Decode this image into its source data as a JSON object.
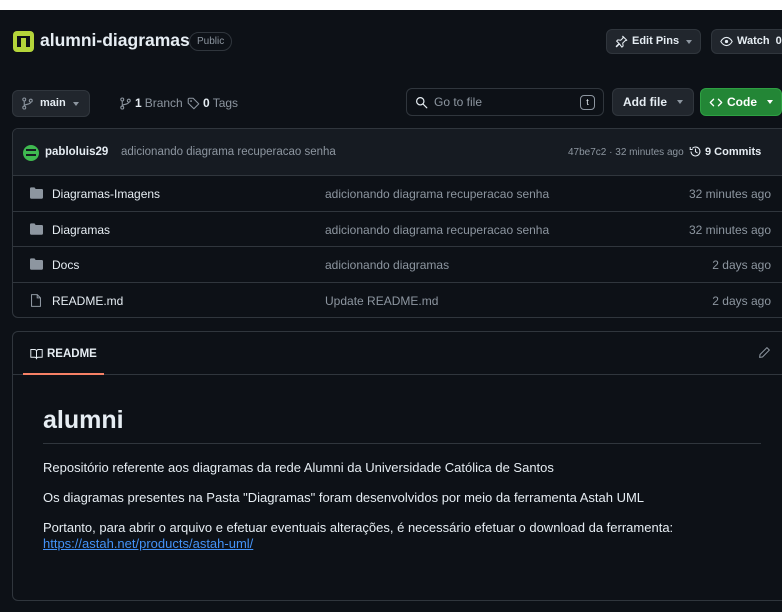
{
  "repo": {
    "name": "alumni-diagramas",
    "visibility": "Public",
    "edit_pins_label": "Edit Pins",
    "watch_label": "Watch",
    "watch_count": "0"
  },
  "toolbar": {
    "branch": "main",
    "branch_count": "1",
    "branch_label": "Branch",
    "tag_count": "0",
    "tag_label": "Tags",
    "goto_placeholder": "Go to file",
    "goto_shortcut": "t",
    "add_file_label": "Add file",
    "code_label": "Code"
  },
  "commit": {
    "author": "pabloluis29",
    "message": "adicionando diagrama recuperacao senha",
    "hash_time": "47be7c2 · 32 minutes ago",
    "commits_label": "9 Commits"
  },
  "files": [
    {
      "name": "Diagramas-Imagens",
      "type": "folder",
      "message": "adicionando diagrama recuperacao senha",
      "age": "32 minutes ago"
    },
    {
      "name": "Diagramas",
      "type": "folder",
      "message": "adicionando diagrama recuperacao senha",
      "age": "32 minutes ago"
    },
    {
      "name": "Docs",
      "type": "folder",
      "message": "adicionando diagramas",
      "age": "2 days ago"
    },
    {
      "name": "README.md",
      "type": "file",
      "message": "Update README.md",
      "age": "2 days ago"
    }
  ],
  "readme": {
    "tab_label": "README",
    "title": "alumni",
    "paragraphs": [
      "Repositório referente aos diagramas da rede Alumni da Universidade Católica de Santos",
      "Os diagramas presentes na Pasta \"Diagramas\" foram desenvolvidos por meio da ferramenta Astah UML",
      "Portanto, para abrir o arquivo e efetuar eventuais alterações, é necessário efetuar o download da ferramenta:"
    ],
    "link": "https://astah.net/products/astah-uml/"
  },
  "colors": {
    "background": "#0d1117",
    "accent_green": "#238636",
    "link": "#4493f8",
    "tab_underline": "#f78166"
  }
}
